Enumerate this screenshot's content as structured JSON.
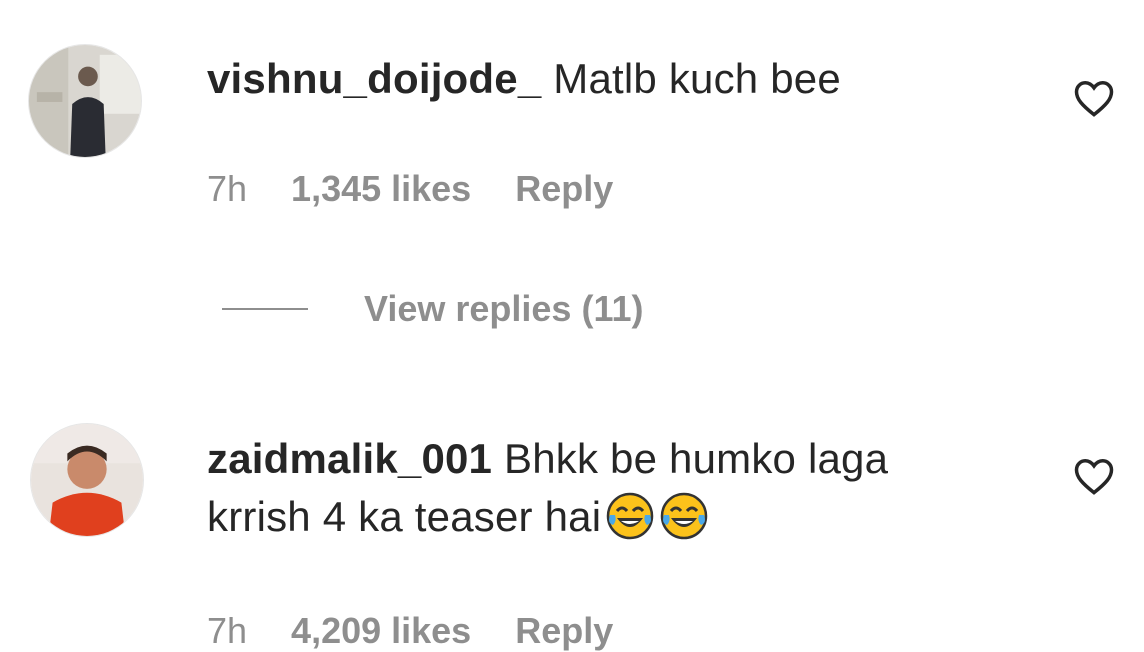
{
  "comments": [
    {
      "username": "vishnu_doijode_",
      "text": "Matlb kuch bee",
      "time": "7h",
      "likes": "1,345 likes",
      "reply_label": "Reply",
      "avatar_icon": "user-avatar-photo",
      "like_icon": "heart-outline-icon"
    },
    {
      "username": "zaidmalik_001",
      "text_line1": "Bhkk be humko laga",
      "text_line2": "krrish 4 ka teaser hai",
      "emoji_count": 2,
      "emoji_icon": "face-with-tears-of-joy-icon",
      "time": "7h",
      "likes": "4,209 likes",
      "reply_label": "Reply",
      "avatar_icon": "user-avatar-photo",
      "like_icon": "heart-outline-icon"
    }
  ],
  "view_replies": {
    "label": "View replies (11)"
  },
  "colors": {
    "text": "#262626",
    "muted": "#8e8e8e",
    "background": "#ffffff",
    "emoji": "#fcc21b"
  }
}
